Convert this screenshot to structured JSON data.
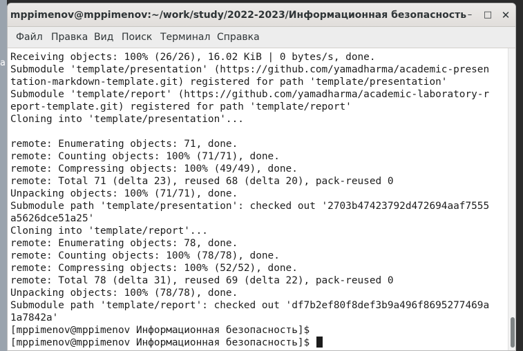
{
  "desktop": {
    "edge_text": "a"
  },
  "window": {
    "title": "mppimenov@mppimenov:~/work/study/2022-2023/Информационная безопасность",
    "buttons": {
      "minimize_icon": "minimize-icon",
      "maximize_icon": "maximize-icon",
      "close_icon": "close-icon"
    }
  },
  "menu": {
    "items": [
      "Файл",
      "Правка",
      "Вид",
      "Поиск",
      "Терминал",
      "Справка"
    ]
  },
  "terminal": {
    "lines": [
      "Receiving objects: 100% (26/26), 16.02 KiB | 0 bytes/s, done.",
      "Submodule 'template/presentation' (https://github.com/yamadharma/academic-presen",
      "tation-markdown-template.git) registered for path 'template/presentation'",
      "Submodule 'template/report' (https://github.com/yamadharma/academic-laboratory-r",
      "eport-template.git) registered for path 'template/report'",
      "Cloning into 'template/presentation'...",
      "",
      "remote: Enumerating objects: 71, done.",
      "remote: Counting objects: 100% (71/71), done.",
      "remote: Compressing objects: 100% (49/49), done.",
      "remote: Total 71 (delta 23), reused 68 (delta 20), pack-reused 0",
      "Unpacking objects: 100% (71/71), done.",
      "Submodule path 'template/presentation': checked out '2703b47423792d472694aaf7555",
      "a5626dce51a25'",
      "Cloning into 'template/report'...",
      "remote: Enumerating objects: 78, done.",
      "remote: Counting objects: 100% (78/78), done.",
      "remote: Compressing objects: 100% (52/52), done.",
      "remote: Total 78 (delta 31), reused 69 (delta 22), pack-reused 0",
      "Unpacking objects: 100% (78/78), done.",
      "Submodule path 'template/report': checked out 'df7b2ef80f8def3b9a496f8695277469a",
      "1a7842a'",
      "[mppimenov@mppimenov Информационная безопасность]$",
      "[mppimenov@mppimenov Информационная безопасность]$ "
    ]
  },
  "colors": {
    "terminal_bg": "#ffffff",
    "terminal_fg": "#1c1c1c",
    "titlebar_bg": "#e4e1de"
  }
}
